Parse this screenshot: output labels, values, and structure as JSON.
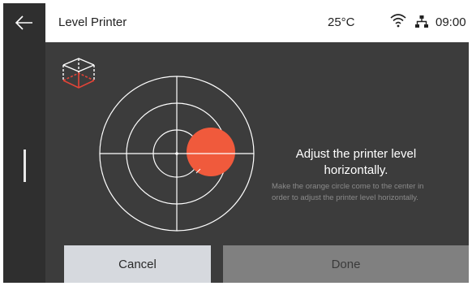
{
  "header": {
    "title": "Level Printer",
    "temperature": "25°C",
    "time": "09:00"
  },
  "icons": {
    "back": "arrow-left-icon",
    "wifi": "wifi-icon",
    "network": "network-icon",
    "cube": "cube-level-icon"
  },
  "colors": {
    "accent": "#f05a3c",
    "background": "#3c3c3c",
    "sidebar": "#2f2f2f",
    "header": "#ffffff"
  },
  "main": {
    "heading": "Adjust the printer level horizontally.",
    "description": "Make the orange circle come to the center in order to adjust the printer level horizontally."
  },
  "buttons": {
    "cancel": "Cancel",
    "done": "Done"
  }
}
